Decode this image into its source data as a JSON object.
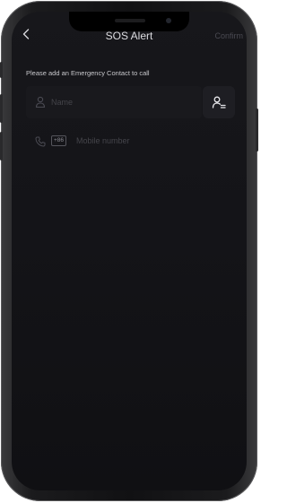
{
  "header": {
    "title": "SOS Alert",
    "confirm_label": "Confirm"
  },
  "hint_text": "Please add an Emergency Contact to call",
  "name_field": {
    "placeholder": "Name"
  },
  "phone_field": {
    "country_code": "+86",
    "placeholder": "Mobile number"
  },
  "icons": {
    "back": "chevron-left-icon",
    "name": "user-icon",
    "contacts": "contacts-icon",
    "phone": "phone-icon"
  },
  "colors": {
    "background": "#141418",
    "field": "#19191d"
  }
}
